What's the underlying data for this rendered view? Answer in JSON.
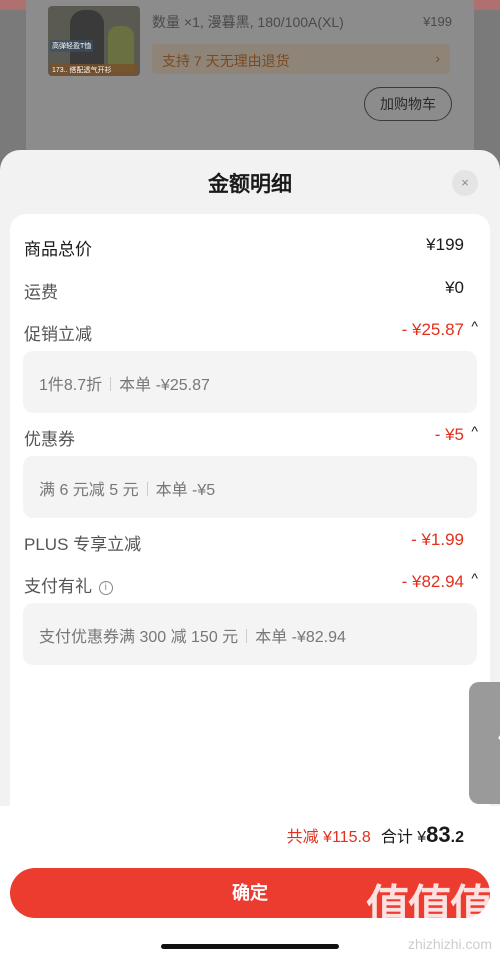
{
  "background": {
    "spec": "数量 ×1, 漫暮黑, 180/100A(XL)",
    "price": "¥199",
    "return_policy": "支持 7 天无理由退货",
    "return_arrow": "›",
    "add_cart": "加购物车",
    "thumb_tag": "高弹轻盈T恤",
    "thumb_tag2": "173.. 搭配透气开衫"
  },
  "sheet": {
    "title": "金额明细",
    "close_icon": "×"
  },
  "rows": {
    "total": {
      "label": "商品总价",
      "value": "¥199"
    },
    "shipping": {
      "label": "运费",
      "value": "¥0"
    },
    "promo": {
      "label": "促销立减",
      "value": "- ¥25.87",
      "caret": "^"
    },
    "promo_detail": {
      "left": "1件8.7折",
      "right": "本单 -¥25.87"
    },
    "coupon": {
      "label": "优惠券",
      "value": "- ¥5",
      "caret": "^"
    },
    "coupon_detail": {
      "left": "满 6 元减 5 元",
      "right": "本单 -¥5"
    },
    "plus": {
      "label": "PLUS 专享立减",
      "value": "- ¥1.99"
    },
    "pay_gift": {
      "label": "支付有礼",
      "info_icon": "i",
      "value": "- ¥82.94",
      "caret": "^"
    },
    "pay_gift_detail": {
      "left": "支付优惠券满 300 减 150 元",
      "right": "本单 -¥82.94"
    }
  },
  "side_handle": "〈",
  "footer": {
    "reduce_label": "共减 ¥115.8",
    "total_prefix": "合计 ¥",
    "total_int": "83",
    "total_dec": ".2",
    "confirm": "确定"
  },
  "watermark": {
    "text": "值值值",
    "url": "zhizhizhi.com"
  },
  "colors": {
    "accent": "#e0301e",
    "button": "#ec3b2f"
  }
}
